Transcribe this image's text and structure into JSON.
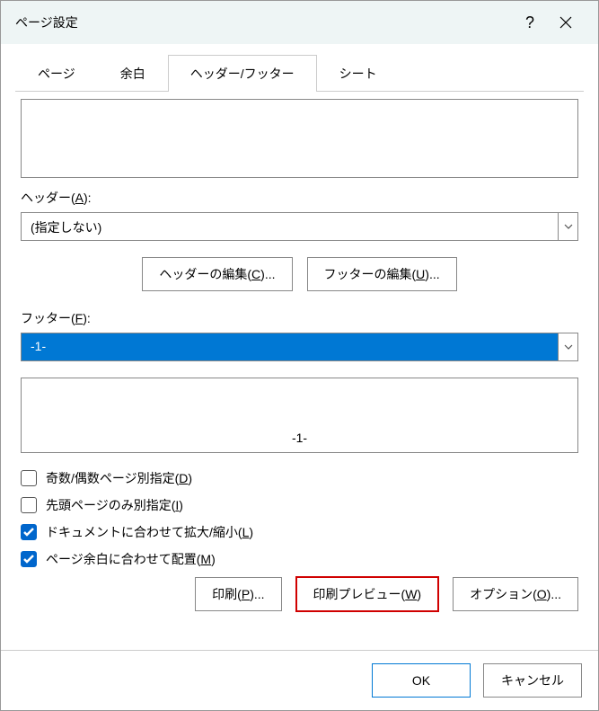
{
  "title": "ページ設定",
  "tabs": {
    "page": "ページ",
    "margins": "余白",
    "headerfooter": "ヘッダー/フッター",
    "sheet": "シート"
  },
  "header_label_pre": "ヘッダー(",
  "header_label_u": "A",
  "header_label_post": "):",
  "header_value": "(指定しない)",
  "btn_edit_header_pre": "ヘッダーの編集(",
  "btn_edit_header_u": "C",
  "btn_edit_header_post": ")...",
  "btn_edit_footer_pre": "フッターの編集(",
  "btn_edit_footer_u": "U",
  "btn_edit_footer_post": ")...",
  "footer_label_pre": "フッター(",
  "footer_label_u": "F",
  "footer_label_post": "):",
  "footer_value": "-1-",
  "footer_preview_text": "-1-",
  "chk_oddeven_pre": "奇数/偶数ページ別指定(",
  "chk_oddeven_u": "D",
  "chk_oddeven_post": ")",
  "chk_firstpage_pre": "先頭ページのみ別指定(",
  "chk_firstpage_u": "I",
  "chk_firstpage_post": ")",
  "chk_scale_pre": "ドキュメントに合わせて拡大/縮小(",
  "chk_scale_u": "L",
  "chk_scale_post": ")",
  "chk_align_pre": "ページ余白に合わせて配置(",
  "chk_align_u": "M",
  "chk_align_post": ")",
  "btn_print_pre": "印刷(",
  "btn_print_u": "P",
  "btn_print_post": ")...",
  "btn_preview_pre": "印刷プレビュー(",
  "btn_preview_u": "W",
  "btn_preview_post": ")",
  "btn_options_pre": "オプション(",
  "btn_options_u": "O",
  "btn_options_post": ")...",
  "btn_ok": "OK",
  "btn_cancel": "キャンセル"
}
